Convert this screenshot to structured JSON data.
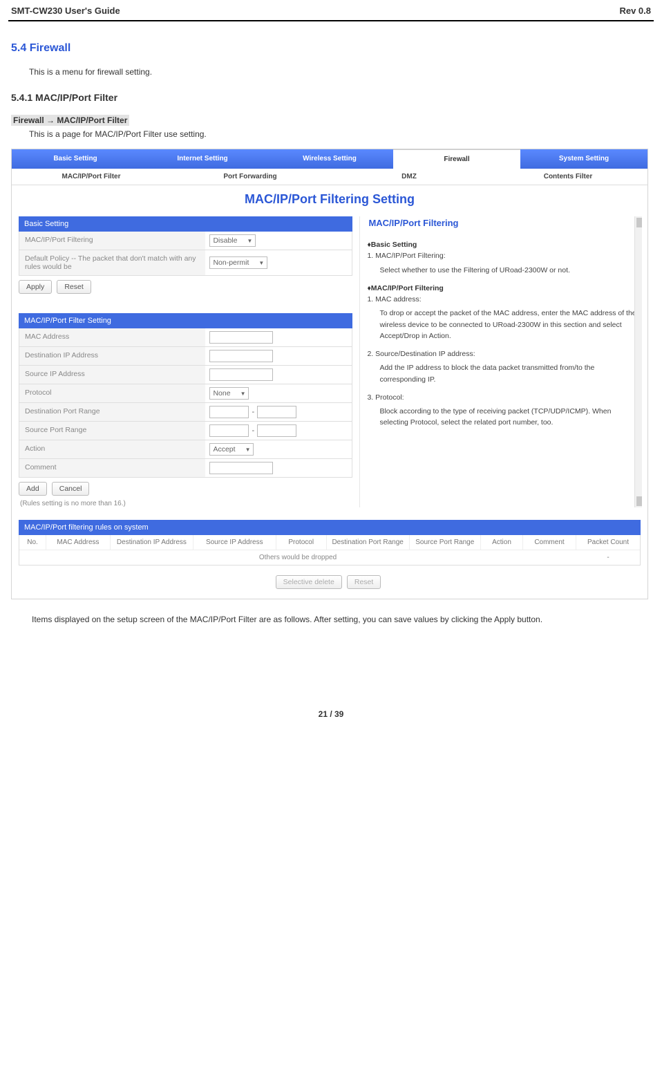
{
  "doc": {
    "header_left": "SMT-CW230 User's Guide",
    "header_right": "Rev 0.8",
    "footer": "21 / 39"
  },
  "section": {
    "number_title": "5.4 Firewall",
    "intro": "This is a menu for firewall setting.",
    "sub_title": "5.4.1 MAC/IP/Port Filter",
    "breadcrumb_a": "Firewall",
    "breadcrumb_arrow": " → ",
    "breadcrumb_b": "MAC/IP/Port Filter",
    "sub_intro": "This is a page for MAC/IP/Port Filter use setting."
  },
  "tabs1": [
    "Basic Setting",
    "Internet Setting",
    "Wireless Setting",
    "Firewall",
    "System Setting"
  ],
  "tabs2": [
    "MAC/IP/Port Filter",
    "Port Forwarding",
    "DMZ",
    "Contents Filter"
  ],
  "panel": {
    "title": "MAC/IP/Port Filtering Setting",
    "basic_hd": "Basic Setting",
    "row_filtering": "MAC/IP/Port Filtering",
    "val_filtering": "Disable",
    "row_policy": "Default Policy -- The packet that don't match with any rules would be",
    "val_policy": "Non-permit",
    "apply": "Apply",
    "reset": "Reset",
    "filter_hd": "MAC/IP/Port Filter Setting",
    "r_mac": "MAC Address",
    "r_dip": "Destination IP Address",
    "r_sip": "Source IP Address",
    "r_proto": "Protocol",
    "v_proto": "None",
    "r_dpr": "Destination Port Range",
    "r_spr": "Source Port Range",
    "r_action": "Action",
    "v_action": "Accept",
    "r_comment": "Comment",
    "add": "Add",
    "cancel": "Cancel",
    "note": "(Rules setting is no more than 16.)"
  },
  "help": {
    "title": "MAC/IP/Port Filtering",
    "h1": "♦Basic Setting",
    "h1_1_label": "1. MAC/IP/Port Filtering:",
    "h1_1_body": "Select whether to use the Filtering of URoad-2300W or not.",
    "h2": "♦MAC/IP/Port Filtering",
    "h2_1_label": "1. MAC address:",
    "h2_1_body": "To drop or accept the packet of the MAC address, enter the MAC address of the wireless device to be connected to URoad-2300W in this section and select Accept/Drop in Action.",
    "h2_2_label": "2. Source/Destination IP address:",
    "h2_2_body": "Add the IP address to block the data packet transmitted from/to the corresponding IP.",
    "h2_3_label": "3. Protocol:",
    "h2_3_body": "Block according to the type of receiving packet (TCP/UDP/ICMP). When selecting Protocol, select the related port number, too."
  },
  "rules": {
    "hd": "MAC/IP/Port filtering rules on system",
    "cols": [
      "No.",
      "MAC Address",
      "Destination IP Address",
      "Source IP Address",
      "Protocol",
      "Destination Port Range",
      "Source Port Range",
      "Action",
      "Comment",
      "Packet Count"
    ],
    "drop": "Others would be dropped",
    "dash": "-",
    "btn_del": "Selective delete",
    "btn_reset": "Reset"
  },
  "follow": "Items displayed on the setup screen of the MAC/IP/Port Filter are as follows. After setting, you can save values by clicking the Apply button."
}
